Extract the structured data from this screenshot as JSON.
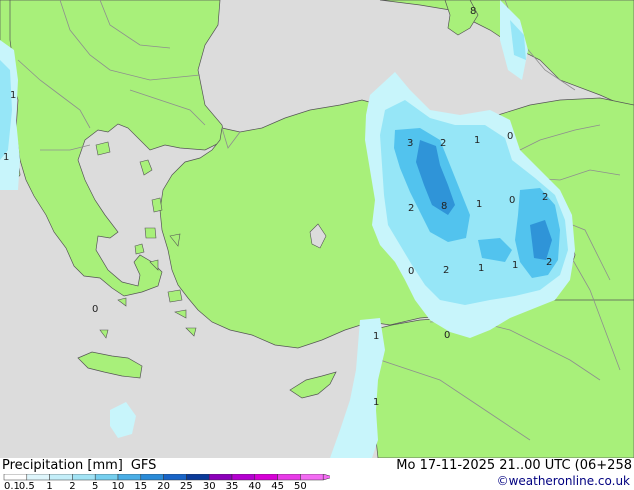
{
  "map": {
    "colors": {
      "sea": "#dcdcdc",
      "land": "#a8f07a",
      "border": "#8e8e8e",
      "coast": "#555555",
      "precip_light": "#c8f5fb",
      "precip_mid": "#96e6f7",
      "precip_heavy": "#52c3ee",
      "precip_strong": "#2f94d8"
    },
    "value_labels": [
      "8",
      "1",
      "1",
      "3",
      "2",
      "1",
      "0",
      "2",
      "8",
      "1",
      "0",
      "2",
      "0",
      "2",
      "1",
      "1",
      "2",
      "0",
      "1",
      "0",
      "1"
    ]
  },
  "legend": {
    "title": "Precipitation [mm]",
    "model": "GFS",
    "ticks": [
      "0.1",
      "0.5",
      "1",
      "2",
      "5",
      "10",
      "15",
      "20",
      "25",
      "30",
      "35",
      "40",
      "45",
      "50"
    ],
    "colors": [
      "#ffffff",
      "#dff6fc",
      "#c4eef9",
      "#a2e3f5",
      "#76cfef",
      "#4aaee6",
      "#2a8bd8",
      "#1864c7",
      "#0a3a99",
      "#8c00ba",
      "#b400d0",
      "#d600d6",
      "#e83ae8",
      "#f36bf3"
    ]
  },
  "footer": {
    "datetime": "Mo 17-11-2025 21..00 UTC (06+258",
    "credit": "©weatheronline.co.uk"
  }
}
